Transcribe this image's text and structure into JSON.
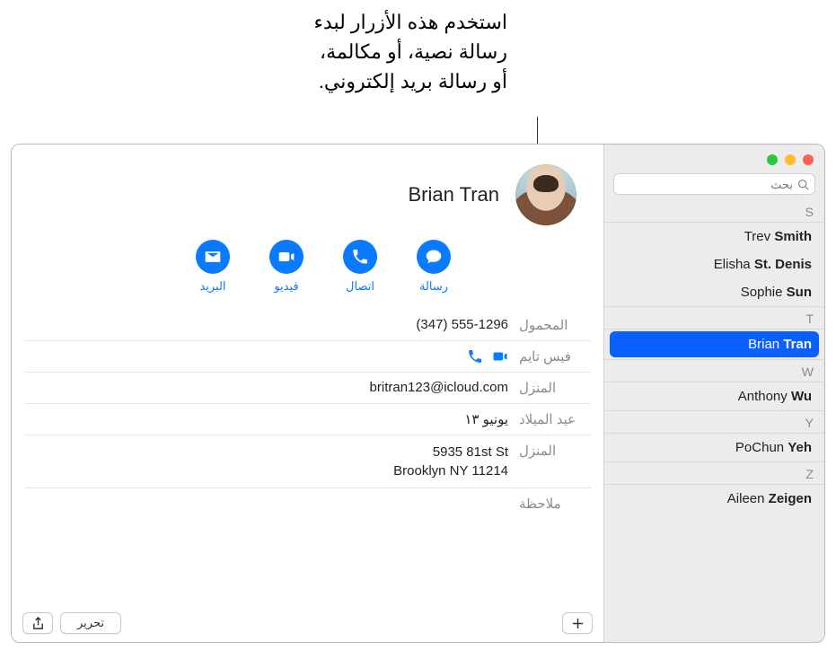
{
  "callout": {
    "line1": "استخدم هذه الأزرار لبدء",
    "line2": "رسالة نصية، أو مكالمة،",
    "line3": "أو رسالة بريد إلكتروني."
  },
  "search": {
    "placeholder": "بحث"
  },
  "sections": {
    "s": {
      "letter": "S",
      "items": [
        {
          "first": "Trev",
          "last": "Smith"
        },
        {
          "first": "Elisha",
          "last": "St. Denis"
        },
        {
          "first": "Sophie",
          "last": "Sun"
        }
      ]
    },
    "t": {
      "letter": "T",
      "items": [
        {
          "first": "Brian",
          "last": "Tran",
          "selected": true
        }
      ]
    },
    "w": {
      "letter": "W",
      "items": [
        {
          "first": "Anthony",
          "last": "Wu"
        }
      ]
    },
    "y": {
      "letter": "Y",
      "items": [
        {
          "first": "PoChun",
          "last": "Yeh"
        }
      ]
    },
    "z": {
      "letter": "Z",
      "items": [
        {
          "first": "Aileen",
          "last": "Zeigen"
        }
      ]
    }
  },
  "contact": {
    "name": "Brian Tran",
    "actions": {
      "message": "رسالة",
      "call": "اتصال",
      "video": "فيديو",
      "mail": "البريد"
    },
    "fields": {
      "mobile_label": "المحمول",
      "mobile_value": "(347) 555-1296",
      "facetime_label": "فيس تايم",
      "home_email_label": "المنزل",
      "home_email_value": "britran123@icloud.com",
      "birthday_label": "عيد الميلاد",
      "birthday_value": "يونيو ١٣",
      "home_addr_label": "المنزل",
      "home_addr_line1": "5935 81st St",
      "home_addr_line2": "Brooklyn NY 11214",
      "note_label": "ملاحظة"
    }
  },
  "footer": {
    "edit": "تحرير"
  }
}
